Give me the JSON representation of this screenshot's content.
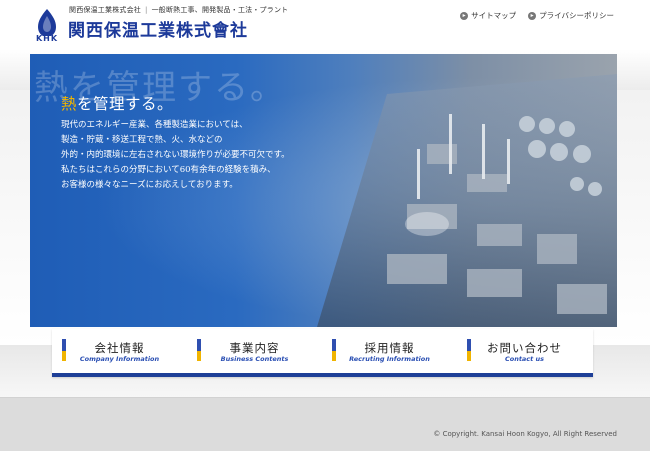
{
  "header": {
    "tagline_company": "関西保温工業株式会社",
    "tagline_business": "一般断熱工事、開発製品・工法・プラント",
    "company_name": "関西保温工業株式會社",
    "logo_letters": "KHK",
    "links": [
      {
        "label": "サイトマップ"
      },
      {
        "label": "プライバシーポリシー"
      }
    ]
  },
  "hero": {
    "watermark": "熱を管理する。",
    "heading_accent": "熱",
    "heading_rest": "を管理する。",
    "body": [
      "現代のエネルギー産業、各種製造業においては、",
      "製造・貯蔵・移送工程で熱、火、水などの",
      "外的・内的環境に左右されない環境作りが必要不可欠です。",
      "私たちはこれらの分野において60有余年の経験を積み、",
      "お客様の様々なニーズにお応えしております。"
    ]
  },
  "menu": [
    {
      "jp": "会社情報",
      "en": "Company Information"
    },
    {
      "jp": "事業内容",
      "en": "Business Contents"
    },
    {
      "jp": "採用情報",
      "en": "Recruting Information"
    },
    {
      "jp": "お問い合わせ",
      "en": "Contact us"
    }
  ],
  "footer": {
    "copyright": "© Copyright. Kansai Hoon Kogyo, All Right Reserved"
  },
  "colors": {
    "brand_blue": "#1d3a9a",
    "accent_yellow": "#f0b400"
  }
}
